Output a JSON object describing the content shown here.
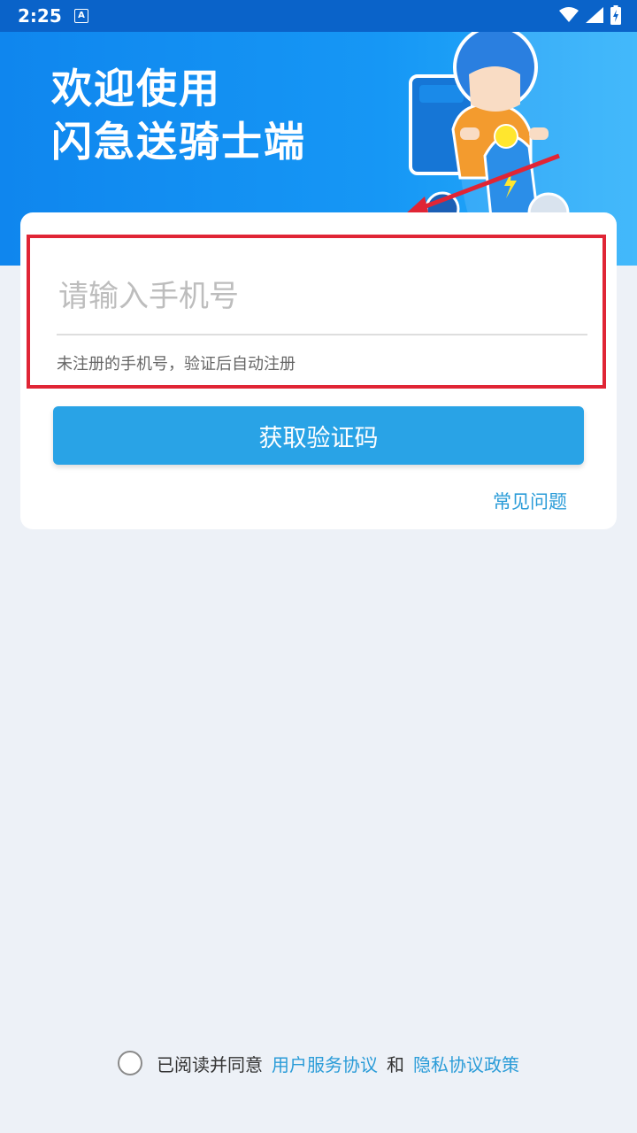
{
  "status_bar": {
    "time": "2:25",
    "app_icon_letter": "A",
    "icons": [
      "wifi-icon",
      "signal-icon",
      "battery-charging-icon"
    ]
  },
  "banner": {
    "title_line1": "欢迎使用",
    "title_line2": "闪急送骑士端"
  },
  "login": {
    "phone_placeholder": "请输入手机号",
    "phone_value": "",
    "hint": "未注册的手机号，验证后自动注册",
    "get_code_label": "获取验证码",
    "faq_label": "常见问题"
  },
  "agreement": {
    "checked": false,
    "prefix": "已阅读并同意",
    "user_agreement": "用户服务协议",
    "and": "和",
    "privacy_policy": "隐私协议政策"
  },
  "colors": {
    "primary": "#29a3e6",
    "banner": "#1697f5",
    "link": "#2b9cd8",
    "highlight_border": "#e02535",
    "background": "#edf1f7"
  }
}
